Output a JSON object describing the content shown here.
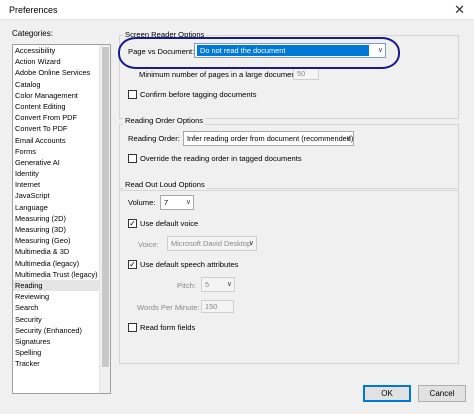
{
  "window": {
    "title": "Preferences",
    "close_glyph": "✕"
  },
  "categories": {
    "label": "Categories:",
    "items": [
      "Accessibility",
      "Action Wizard",
      "Adobe Online Services",
      "Catalog",
      "Color Management",
      "Content Editing",
      "Convert From PDF",
      "Convert To PDF",
      "Email Accounts",
      "Forms",
      "Generative AI",
      "Identity",
      "Internet",
      "JavaScript",
      "Language",
      "Measuring (2D)",
      "Measuring (3D)",
      "Measuring (Geo)",
      "Multimedia & 3D",
      "Multimedia (legacy)",
      "Multimedia Trust (legacy)",
      "Reading",
      "Reviewing",
      "Search",
      "Security",
      "Security (Enhanced)",
      "Signatures",
      "Spelling",
      "Tracker"
    ],
    "selected": "Reading"
  },
  "screen_reader": {
    "title": "Screen Reader Options",
    "page_vs_doc_label": "Page vs Document:",
    "page_vs_doc_value": "Do not read the document",
    "min_pages_label": "Minimum number of pages in a large document:",
    "min_pages_value": "50",
    "confirm_label": "Confirm before tagging documents",
    "confirm_checked": false
  },
  "reading_order": {
    "title": "Reading Order Options",
    "order_label": "Reading Order:",
    "order_value": "Infer reading order from document (recommended)",
    "override_label": "Override the reading order in tagged documents",
    "override_checked": false
  },
  "read_out_loud": {
    "title": "Read Out Loud Options",
    "volume_label": "Volume:",
    "volume_value": "7",
    "default_voice_label": "Use default voice",
    "default_voice_checked": true,
    "voice_label": "Voice:",
    "voice_value": "Microsoft David Desktop",
    "default_speech_label": "Use default speech attributes",
    "default_speech_checked": true,
    "pitch_label": "Pitch:",
    "pitch_value": "5",
    "wpm_label": "Words Per Minute:",
    "wpm_value": "150",
    "form_fields_label": "Read form fields",
    "form_fields_checked": false
  },
  "buttons": {
    "ok": "OK",
    "cancel": "Cancel"
  },
  "colors": {
    "selection": "#0078d7",
    "annotation": "#1a1a8a"
  }
}
